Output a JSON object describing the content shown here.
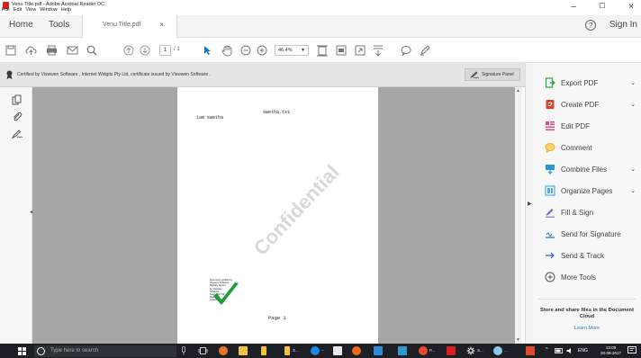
{
  "window": {
    "title": "Venu Title.pdf - Adobe Acrobat Reader DC",
    "menu": [
      "File",
      "Edit",
      "View",
      "Window",
      "Help"
    ],
    "controls": {
      "minimize": "–",
      "maximize": "☐",
      "close": "×"
    }
  },
  "tabs": {
    "home": "Home",
    "tools": "Tools",
    "document": "Venu Title.pdf",
    "close": "×",
    "help": "?",
    "signin": "Sign In"
  },
  "toolbar": {
    "page_current": "1",
    "page_total": "/ 1",
    "zoom": "46.4%"
  },
  "certbar": {
    "text": "Certified by Viswwen Software , Internet Widgits Pty Ltd, certificate issued by Viswwen Software .",
    "signature_panel": "Signature Panel"
  },
  "document": {
    "filename": "swetha.txt",
    "body": "iam swetha",
    "watermark": "Confidential",
    "stamp_lines": [
      "Document certified by",
      "Viswwen Software",
      "Digitally signed",
      "by Viswwen",
      "Software",
      "Date: 2017.09",
      "Reason:",
      "Location:"
    ],
    "footer": "Page 1"
  },
  "right_pane": {
    "items": [
      {
        "label": "Export PDF",
        "icon": "export-pdf-icon",
        "color": "#2da44e",
        "chevron": true
      },
      {
        "label": "Create PDF",
        "icon": "create-pdf-icon",
        "color": "#e0412f",
        "chevron": true
      },
      {
        "label": "Edit PDF",
        "icon": "edit-pdf-icon",
        "color": "#d74b8a",
        "chevron": false
      },
      {
        "label": "Comment",
        "icon": "comment-icon",
        "color": "#f0b428",
        "chevron": false
      },
      {
        "label": "Combine Files",
        "icon": "combine-files-icon",
        "color": "#2d9ad4",
        "chevron": true
      },
      {
        "label": "Organize Pages",
        "icon": "organize-pages-icon",
        "color": "#4cb0e3",
        "chevron": true
      },
      {
        "label": "Fill & Sign",
        "icon": "fill-sign-icon",
        "color": "#7b5cd0",
        "chevron": false
      },
      {
        "label": "Send for Signature",
        "icon": "send-signature-icon",
        "color": "#2c6ac7",
        "chevron": false
      },
      {
        "label": "Send & Track",
        "icon": "send-track-icon",
        "color": "#2c6ac7",
        "chevron": false
      },
      {
        "label": "More Tools",
        "icon": "more-tools-icon",
        "color": "#555555",
        "chevron": false
      }
    ],
    "store_text": "Store and share files in the Document Cloud",
    "learn_more": "Learn More"
  },
  "taskbar": {
    "search_placeholder": "Type here to search",
    "labels": [
      "S...",
      "P...",
      "S...",
      "...",
      "S..."
    ],
    "language": "ENG",
    "time": "13:09",
    "date": "20-09-2017"
  },
  "colors": {
    "accent": "#2b7bd1",
    "taskbar": "#1c1f26",
    "doc_background": "#a6a6a6"
  }
}
